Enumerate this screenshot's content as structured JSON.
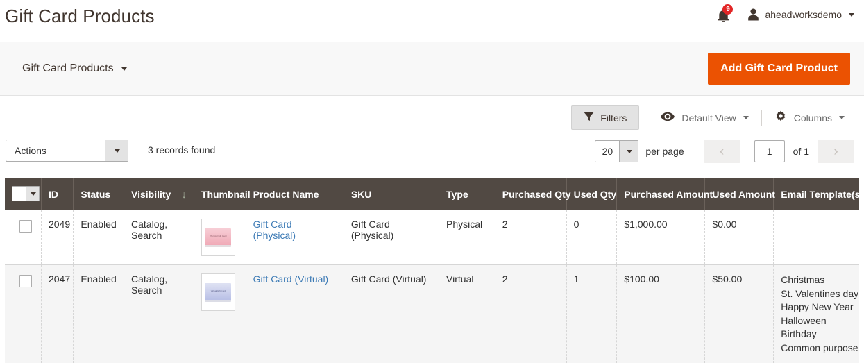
{
  "header": {
    "title": "Gift Card Products",
    "notifications": {
      "icon": "bell-icon",
      "count": "9"
    },
    "user": {
      "icon": "user-icon",
      "name": "aheadworksdemo"
    }
  },
  "page_actions": {
    "switcher_label": "Gift Card Products",
    "add_button_label": "Add Gift Card Product",
    "accent_color": "#eb5202"
  },
  "toolbar": {
    "filters_label": "Filters",
    "filters_icon": "funnel-icon",
    "view_label": "Default View",
    "view_icon": "eye-icon",
    "columns_label": "Columns",
    "columns_icon": "gear-icon"
  },
  "actions_bar": {
    "actions_label": "Actions",
    "records_found": "3 records found",
    "per_page_value": "20",
    "per_page_label": "per page",
    "current_page": "1",
    "page_of": "of 1",
    "prev_icon": "chevron-left-icon",
    "next_icon": "chevron-right-icon"
  },
  "grid": {
    "columns": [
      {
        "key": "check",
        "label": ""
      },
      {
        "key": "id",
        "label": "ID"
      },
      {
        "key": "status",
        "label": "Status"
      },
      {
        "key": "visibility",
        "label": "Visibility"
      },
      {
        "key": "thumbnail",
        "label": "Thumbnail"
      },
      {
        "key": "name",
        "label": "Product Name"
      },
      {
        "key": "sku",
        "label": "SKU"
      },
      {
        "key": "type",
        "label": "Type"
      },
      {
        "key": "purchased_qty",
        "label": "Purchased Qty"
      },
      {
        "key": "used_qty",
        "label": "Used Qty"
      },
      {
        "key": "purchased_amount",
        "label": "Purchased Amount"
      },
      {
        "key": "used_amount",
        "label": "Used Amount"
      },
      {
        "key": "email_templates",
        "label": "Email Template(s)"
      }
    ],
    "sorted_column": "visibility",
    "sort_direction_icon": "↓",
    "header_bg": "#514943",
    "link_color": "#3c7ab5",
    "rows": [
      {
        "id": "2049",
        "status": "Enabled",
        "visibility": "Catalog, Search",
        "thumbnail_label": "Physical Gift Card",
        "name": "Gift Card (Physical)",
        "sku": "Gift Card (Physical)",
        "type": "Physical",
        "purchased_qty": "2",
        "used_qty": "0",
        "purchased_amount": "$1,000.00",
        "used_amount": "$0.00",
        "email_templates": []
      },
      {
        "id": "2047",
        "status": "Enabled",
        "visibility": "Catalog, Search",
        "thumbnail_label": "Virtual Gift Card",
        "name": "Gift Card (Virtual)",
        "sku": "Gift Card (Virtual)",
        "type": "Virtual",
        "purchased_qty": "2",
        "used_qty": "1",
        "purchased_amount": "$100.00",
        "used_amount": "$50.00",
        "email_templates": [
          "Christmas",
          "St. Valentines day",
          "Happy New Year",
          "Halloween",
          "Birthday",
          "Common purpose"
        ]
      }
    ]
  }
}
